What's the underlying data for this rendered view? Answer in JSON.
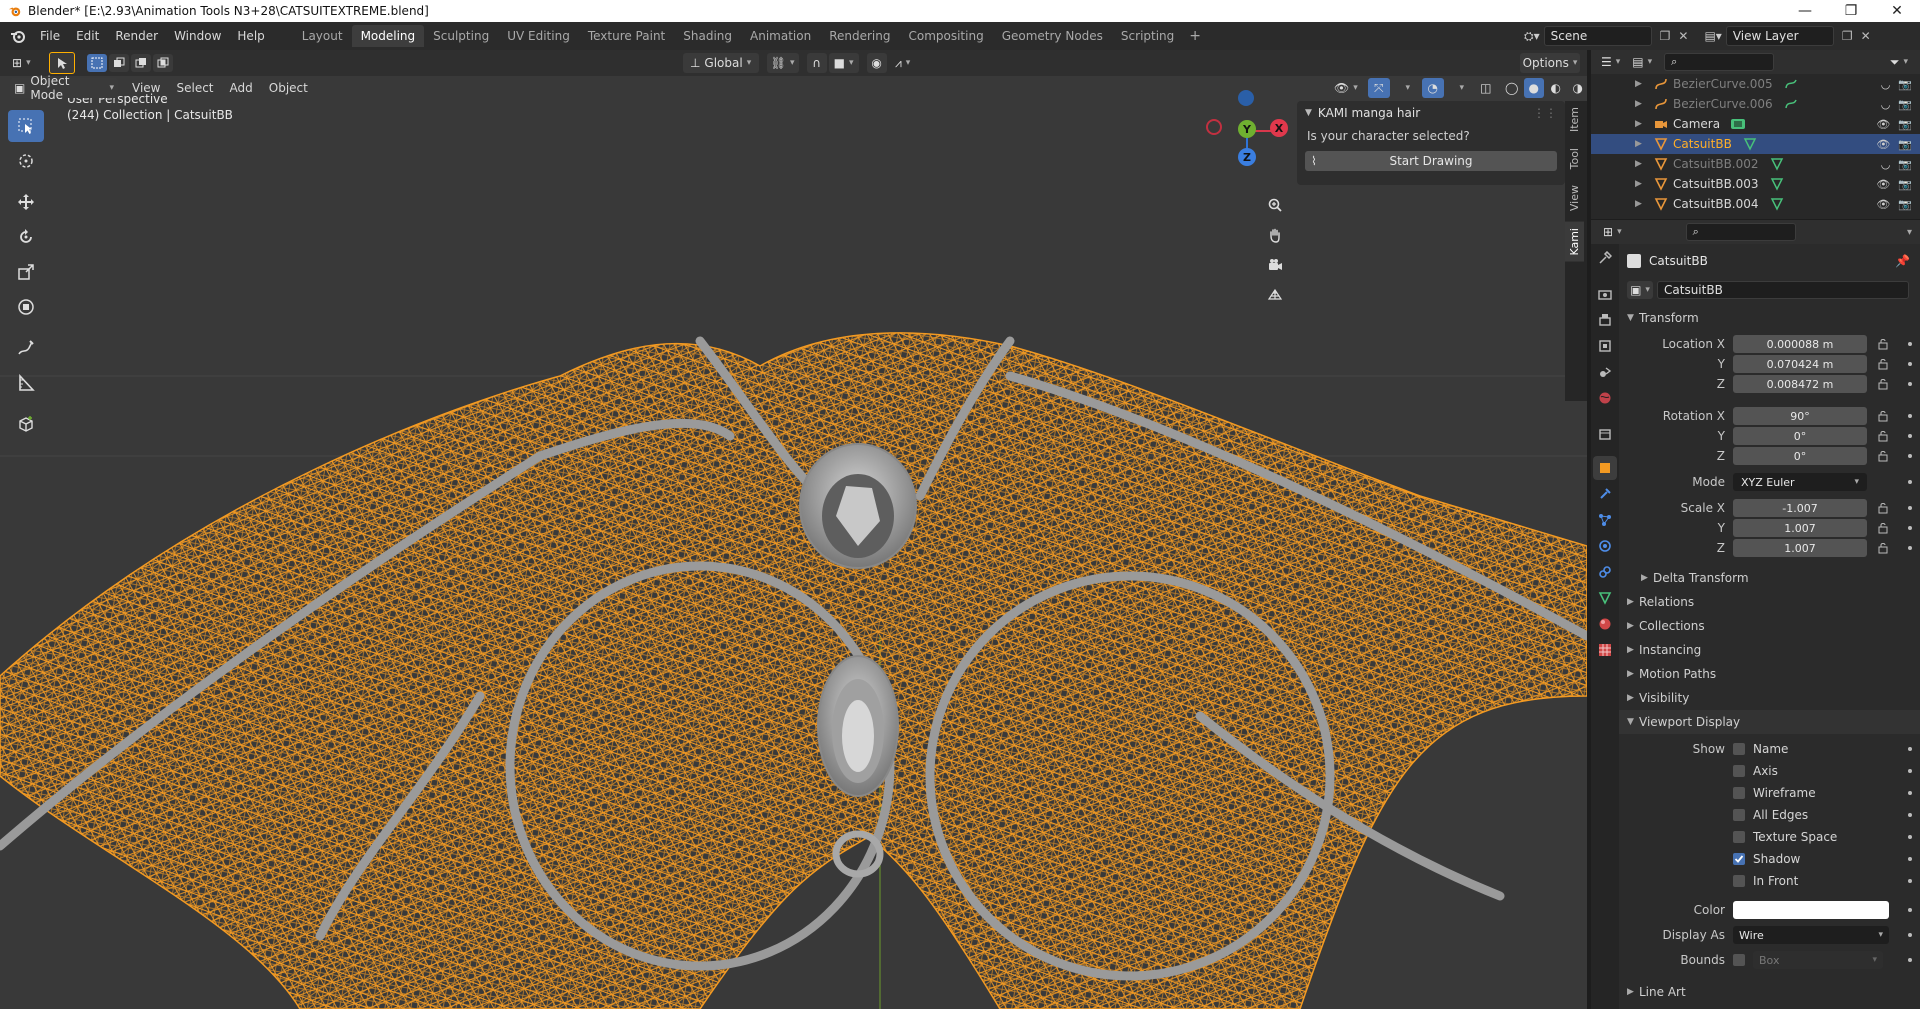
{
  "window": {
    "title": "Blender* [E:\\2.93\\Animation Tools N3+28\\CATSUITEXTREME.blend]",
    "minimize": "—",
    "maximize": "❐",
    "close": "✕"
  },
  "menu": [
    "File",
    "Edit",
    "Render",
    "Window",
    "Help"
  ],
  "workspaces": [
    {
      "label": "Layout",
      "active": false
    },
    {
      "label": "Modeling",
      "active": true
    },
    {
      "label": "Sculpting",
      "active": false
    },
    {
      "label": "UV Editing",
      "active": false
    },
    {
      "label": "Texture Paint",
      "active": false
    },
    {
      "label": "Shading",
      "active": false
    },
    {
      "label": "Animation",
      "active": false
    },
    {
      "label": "Rendering",
      "active": false
    },
    {
      "label": "Compositing",
      "active": false
    },
    {
      "label": "Geometry Nodes",
      "active": false
    },
    {
      "label": "Scripting",
      "active": false
    }
  ],
  "scene": {
    "name": "Scene",
    "view_layer": "View Layer"
  },
  "viewport": {
    "orientation": "Global",
    "options": "Options",
    "mode": "Object Mode",
    "menus": [
      "View",
      "Select",
      "Add",
      "Object"
    ],
    "perspective": "User Perspective",
    "collection_info": "(244) Collection | CatsuitBB",
    "gizmo": {
      "x": "X",
      "y": "Y",
      "z": "Z"
    }
  },
  "npanel": {
    "title": "KAMI manga hair",
    "question": "Is your character selected?",
    "button": "Start Drawing",
    "tabs": [
      "Item",
      "Tool",
      "View",
      "Kami"
    ]
  },
  "outliner": {
    "rows": [
      {
        "name": "BezierCurve.005",
        "style": "dim",
        "icon": "curve"
      },
      {
        "name": "BezierCurve.006",
        "style": "dim",
        "icon": "curve"
      },
      {
        "name": "Camera",
        "style": "normal",
        "icon": "camera"
      },
      {
        "name": "CatsuitBB",
        "style": "hl",
        "icon": "mesh"
      },
      {
        "name": "CatsuitBB.002",
        "style": "dim",
        "icon": "mesh"
      },
      {
        "name": "CatsuitBB.003",
        "style": "normal",
        "icon": "mesh"
      },
      {
        "name": "CatsuitBB.004",
        "style": "normal",
        "icon": "mesh"
      }
    ]
  },
  "properties": {
    "object_name": "CatsuitBB",
    "object_field": "CatsuitBB",
    "transform": {
      "title": "Transform",
      "location_label": "Location X",
      "location": [
        "0.000088 m",
        "0.070424 m",
        "0.008472 m"
      ],
      "rotation_label": "Rotation X",
      "rotation": [
        "90°",
        "0°",
        "0°"
      ],
      "mode_label": "Mode",
      "mode": "XYZ Euler",
      "scale_label": "Scale X",
      "scale": [
        "-1.007",
        "1.007",
        "1.007"
      ],
      "y": "Y",
      "z": "Z",
      "delta": "Delta Transform"
    },
    "sections": [
      "Relations",
      "Collections",
      "Instancing",
      "Motion Paths",
      "Visibility"
    ],
    "viewport_display": {
      "title": "Viewport Display",
      "show_label": "Show",
      "checks": [
        {
          "label": "Name",
          "on": false
        },
        {
          "label": "Axis",
          "on": false
        },
        {
          "label": "Wireframe",
          "on": false
        },
        {
          "label": "All Edges",
          "on": false
        },
        {
          "label": "Texture Space",
          "on": false
        },
        {
          "label": "Shadow",
          "on": true
        },
        {
          "label": "In Front",
          "on": false
        }
      ],
      "color_label": "Color",
      "display_as_label": "Display As",
      "display_as": "Wire",
      "bounds_label": "Bounds",
      "bounds": "Box"
    },
    "line_art": "Line Art"
  },
  "colors": {
    "accent": "#4772b3",
    "wire": "#f39a22",
    "selected_text": "#ffaf29"
  }
}
